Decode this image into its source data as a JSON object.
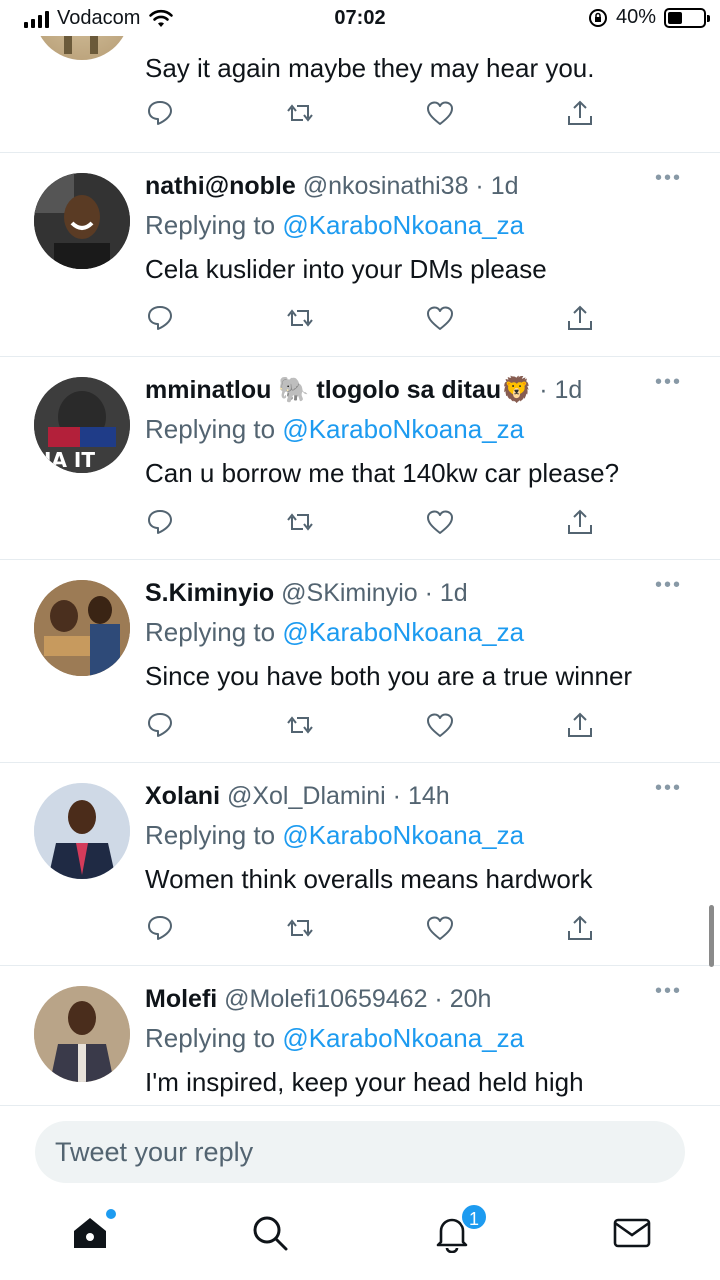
{
  "status_bar": {
    "carrier": "Vodacom",
    "time": "07:02",
    "battery": "40%",
    "battery_level": 0.4
  },
  "top_tweet": {
    "text": "Say it again maybe they may hear you."
  },
  "tweets": [
    {
      "name": "nathi@noble",
      "handle": "@nkosinathi38",
      "time": "1d",
      "replying_prefix": "Replying to",
      "replying_to": "@KaraboNkoana_za",
      "text": "Cela kuslider into your DMs please"
    },
    {
      "name": "mminatlou 🐘 tlogolo sa ditau🦁",
      "handle": "",
      "time": "1d",
      "replying_prefix": "Replying to",
      "replying_to": "@KaraboNkoana_za",
      "text": "Can u borrow me that 140kw car please?"
    },
    {
      "name": "S.Kiminyio",
      "handle": "@SKiminyio",
      "time": "1d",
      "replying_prefix": "Replying to",
      "replying_to": "@KaraboNkoana_za",
      "text": "Since you have both you are a true winner"
    },
    {
      "name": "Xolani",
      "handle": "@Xol_Dlamini",
      "time": "14h",
      "replying_prefix": "Replying to",
      "replying_to": "@KaraboNkoana_za",
      "text": "Women think overalls means hardwork"
    },
    {
      "name": "Molefi",
      "handle": "@Molefi10659462",
      "time": "20h",
      "replying_prefix": "Replying to",
      "replying_to": "@KaraboNkoana_za",
      "text": "I'm inspired, keep your head held high"
    }
  ],
  "reply_box": {
    "placeholder": "Tweet your reply"
  },
  "nav": {
    "notification_count": "1",
    "icons": [
      "home-icon",
      "search-icon",
      "bell-icon",
      "mail-icon"
    ]
  },
  "colors": {
    "accent": "#1d9bf0",
    "secondary_text": "#536471",
    "divider": "#e6ecf0"
  }
}
